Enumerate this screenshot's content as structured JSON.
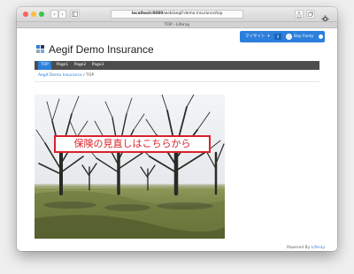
{
  "browser": {
    "address": {
      "host": "localhost:8080",
      "path": "/web/aegif-demo-insurance/top"
    },
    "tab_title": "TOP - Liferay",
    "nav_back": "‹",
    "nav_forward": "›"
  },
  "dockbar": {
    "mysite_label": "マイサイト",
    "notification_count": "0",
    "user_name": "Bay Fanty"
  },
  "site": {
    "title": "Aegif Demo Insurance",
    "brand_colors": [
      "#2c7fdc",
      "#1f3a6b",
      "#6fa8e0",
      "#9aa4b1"
    ]
  },
  "nav": {
    "items": [
      {
        "label": "TOP",
        "active": true
      },
      {
        "label": "Page1",
        "active": false
      },
      {
        "label": "Page2",
        "active": false
      },
      {
        "label": "Page3",
        "active": false
      }
    ]
  },
  "breadcrumb": {
    "home": "Aegif Demo Insurance",
    "separator": "/",
    "current": "TOP"
  },
  "banner": {
    "text": "保険の見直しはこちらから",
    "border_color": "#d8222a"
  },
  "footer": {
    "powered_by": "Powered By",
    "link": "Liferay"
  }
}
